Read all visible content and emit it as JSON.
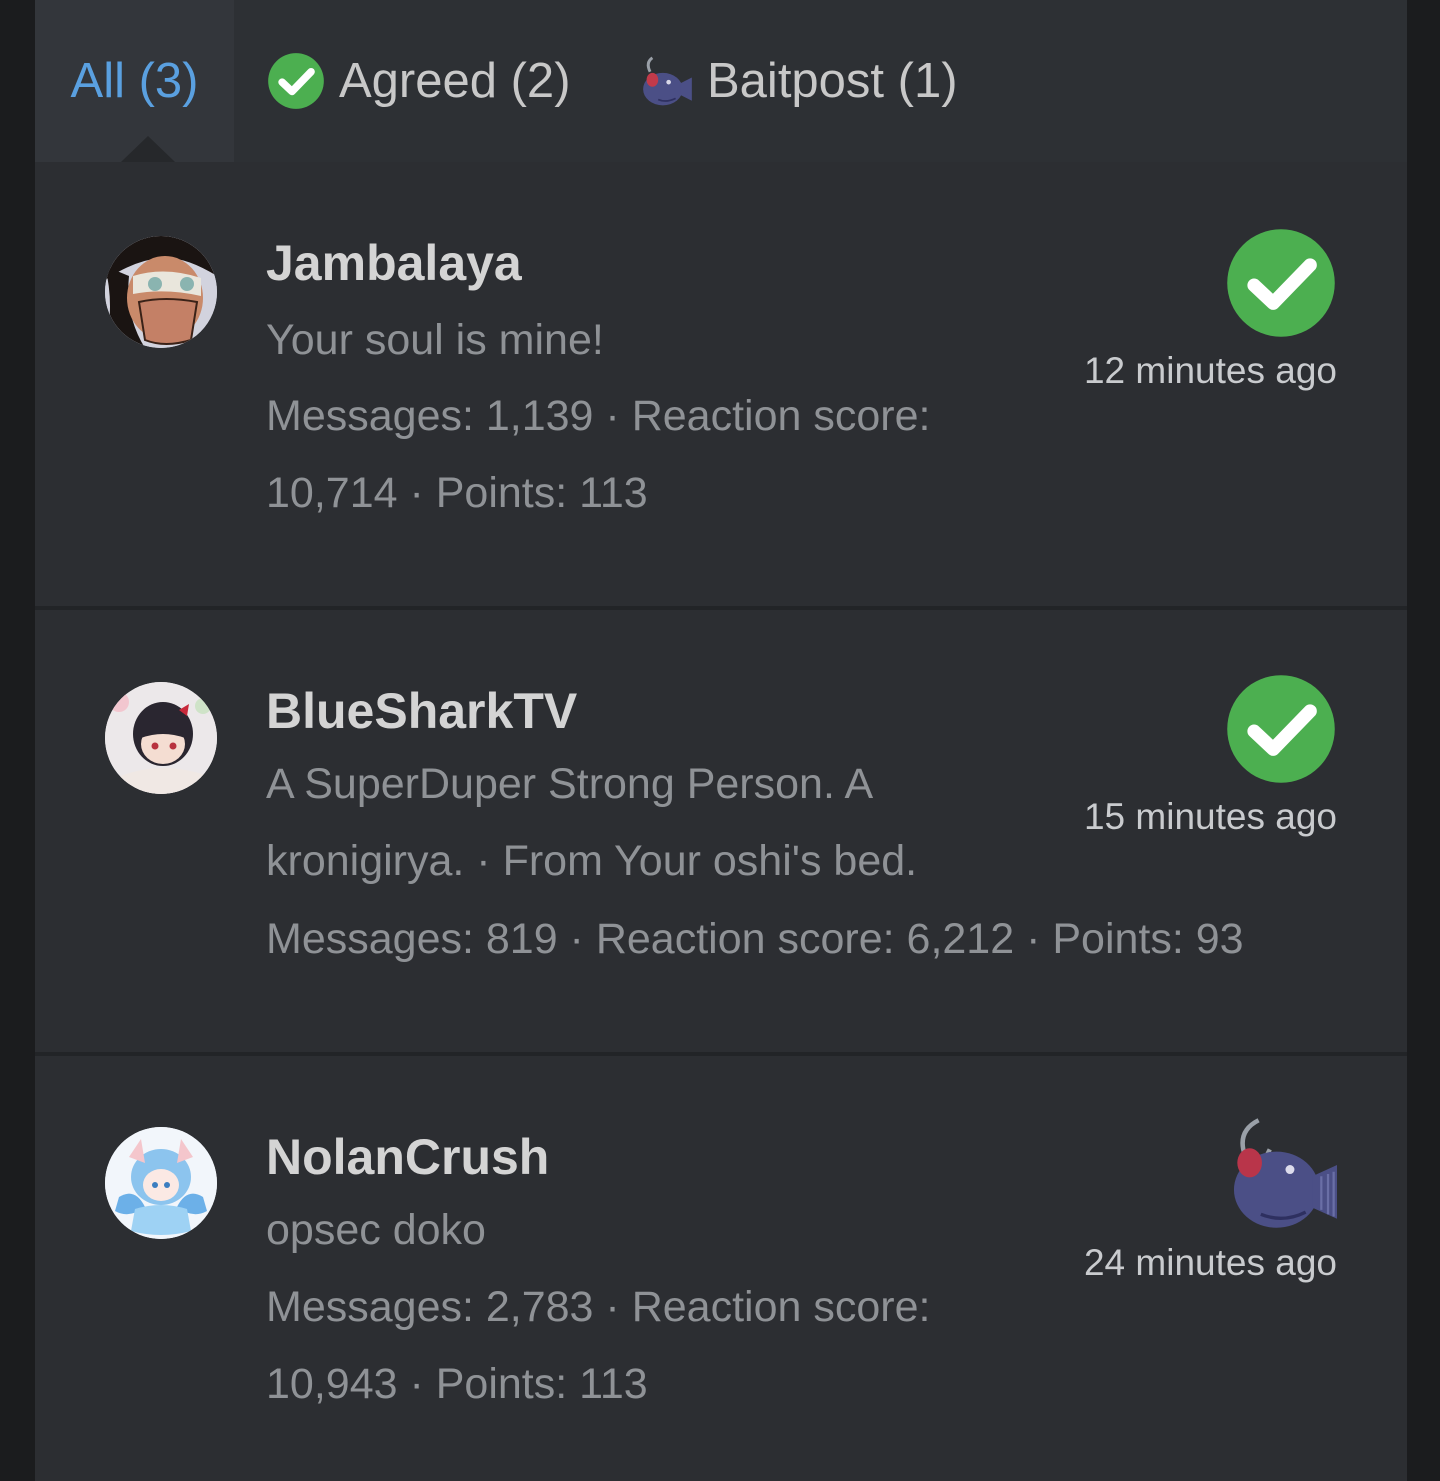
{
  "tabs": {
    "all": "All (3)",
    "agreed": "Agreed (2)",
    "baitpost": "Baitpost (1)"
  },
  "reactions": [
    {
      "username": "Jambalaya",
      "title": "Your soul is mine!",
      "stats": "Messages: 1,139 · Reaction score: 10,714 · Points: 113",
      "reaction": "agreed-check-icon",
      "time": "12 minutes ago"
    },
    {
      "username": "BlueSharkTV",
      "title": "A SuperDuper Strong Person. A kronigirya. · From Your oshi's bed.",
      "stats": "Messages: 819 · Reaction score: 6,212 · Points: 93",
      "reaction": "agreed-check-icon",
      "time": "15 minutes ago"
    },
    {
      "username": "NolanCrush",
      "title": "opsec doko",
      "stats": "Messages: 2,783 · Reaction score: 10,943 · Points: 113",
      "reaction": "baitpost-fish-icon",
      "time": "24 minutes ago"
    }
  ],
  "colors": {
    "active_tab": "#5aa0e0",
    "agreed_green": "#4caf50",
    "bait_fish": "#4b4f86"
  }
}
